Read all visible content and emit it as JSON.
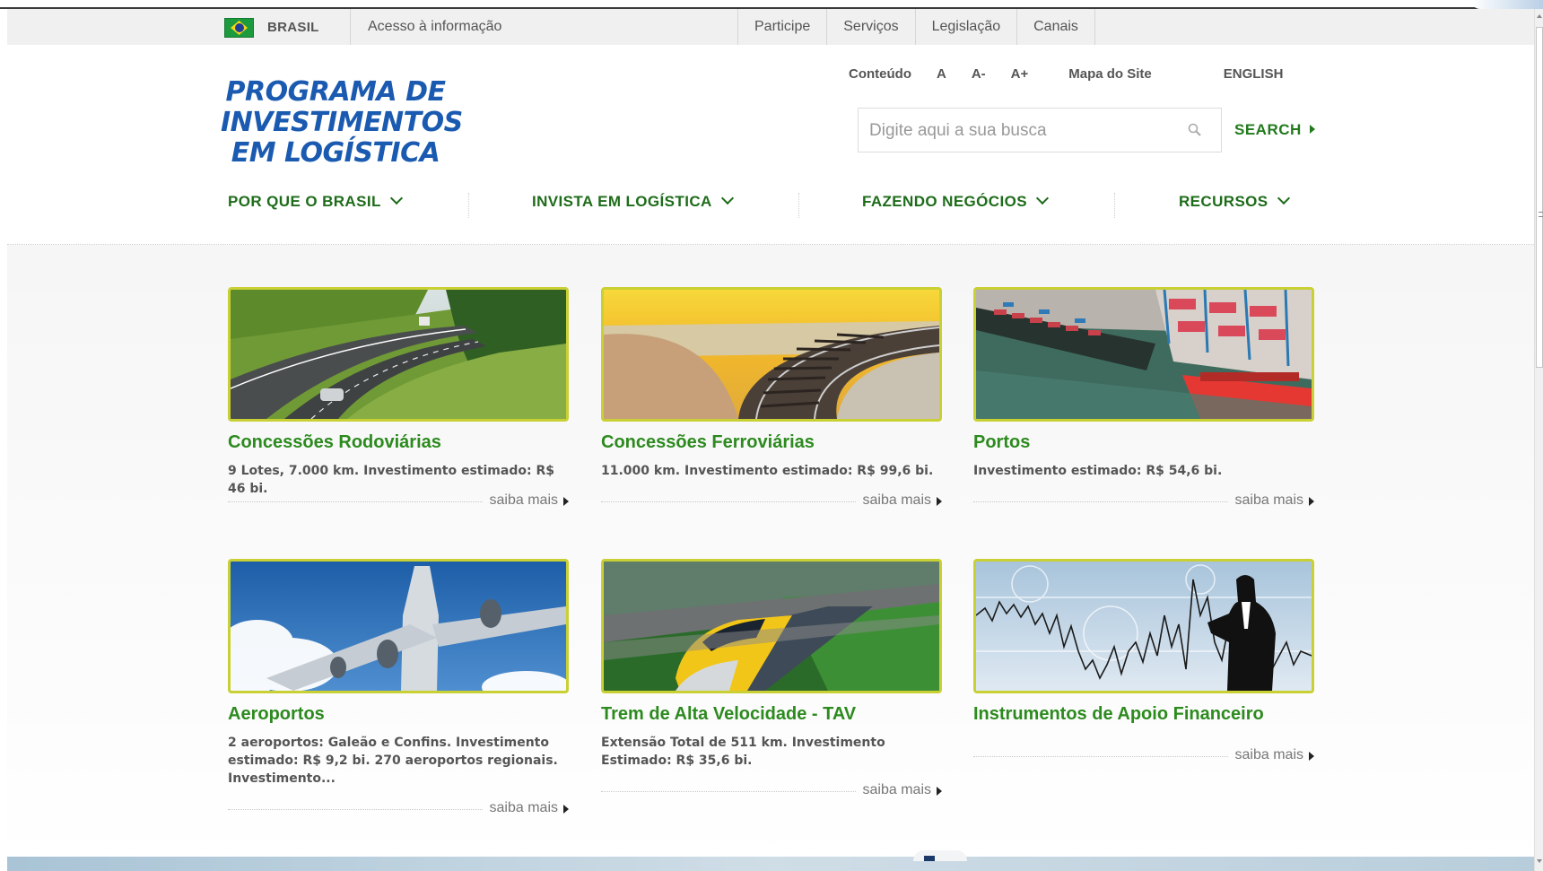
{
  "govbar": {
    "country": "BRASIL",
    "access_info": "Acesso à informação",
    "links": [
      "Participe",
      "Serviços",
      "Legislação",
      "Canais"
    ]
  },
  "logo": {
    "lines": [
      "PROGRAMA DE",
      "INVESTIMENTOS",
      "EM LOGÍSTICA"
    ]
  },
  "accessibility": {
    "content": "Conteúdo",
    "font_normal": "A",
    "font_smaller": "A-",
    "font_larger": "A+",
    "sitemap": "Mapa do Site",
    "english": "ENGLISH"
  },
  "search": {
    "placeholder": "Digite aqui a sua busca",
    "button": "SEARCH"
  },
  "nav": {
    "items": [
      "POR QUE O BRASIL",
      "INVISTA EM LOGÍSTICA",
      "FAZENDO NEGÓCIOS",
      "RECURSOS"
    ]
  },
  "colors": {
    "brand_blue": "#1a5ab0",
    "brand_green": "#2c8a1e",
    "thumb_border": "#c9d034"
  },
  "cards": [
    {
      "title": "Concessões Rodoviárias",
      "desc": "9 Lotes, 7.000 km. Investimento estimado: R$ 46 bi.",
      "more": "saiba mais",
      "image": "highway-photo"
    },
    {
      "title": "Concessões Ferroviárias",
      "desc": "11.000 km. Investimento estimado: R$ 99,6 bi.",
      "more": "saiba mais",
      "image": "railway-photo"
    },
    {
      "title": "Portos",
      "desc": "Investimento estimado: R$ 54,6 bi.",
      "more": "saiba mais",
      "image": "port-photo"
    },
    {
      "title": "Aeroportos",
      "desc": "2 aeroportos: Galeão e Confins. Investimento estimado: R$ 9,2 bi. 270 aeroportos regionais. Investimento...",
      "more": "saiba mais",
      "image": "airplane-photo"
    },
    {
      "title": "Trem de Alta Velocidade - TAV",
      "desc": "Extensão Total de 511 km. Investimento Estimado: R$ 35,6 bi.",
      "more": "saiba mais",
      "image": "train-photo"
    },
    {
      "title": "Instrumentos de Apoio Financeiro",
      "desc": "",
      "more": "saiba mais",
      "image": "finance-photo"
    }
  ]
}
